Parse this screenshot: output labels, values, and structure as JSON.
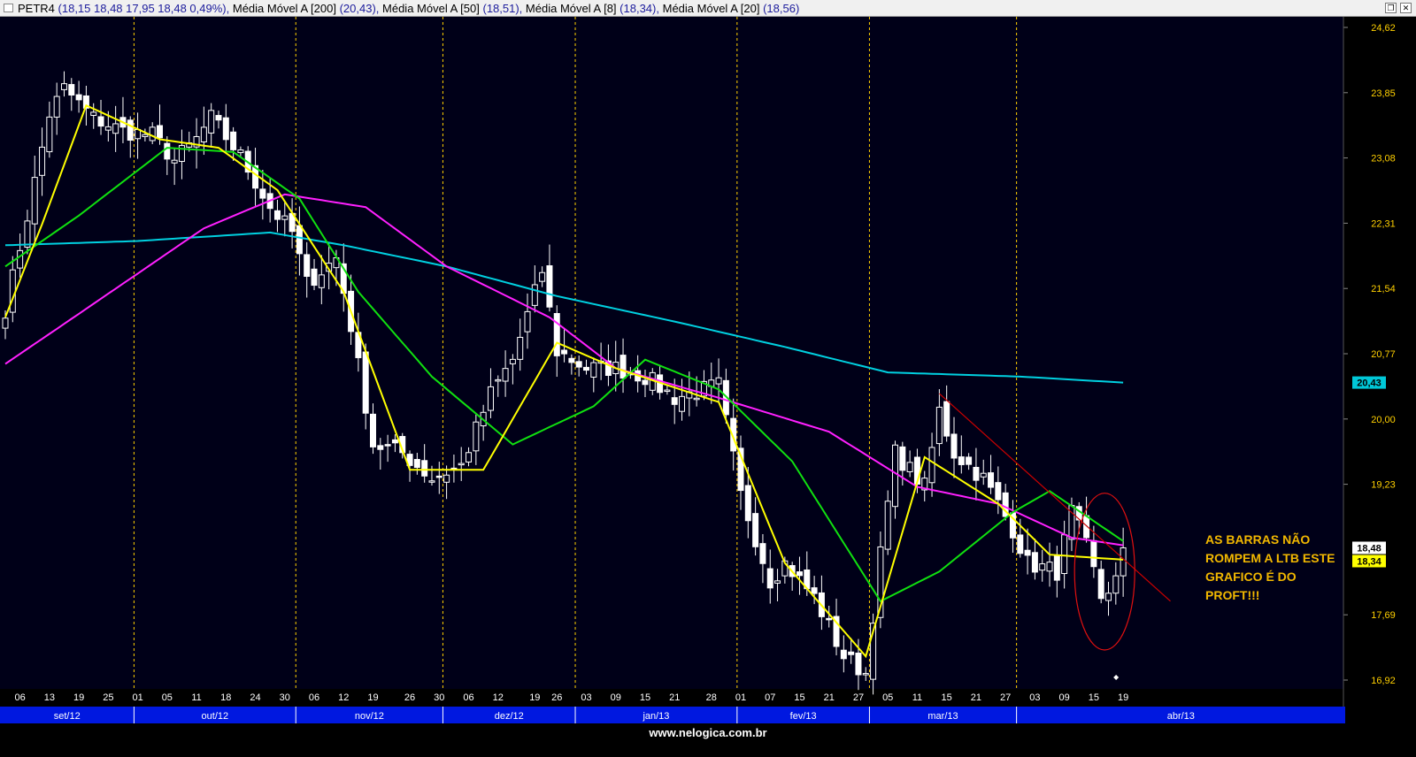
{
  "header": {
    "ticker": "PETR4",
    "ticker_values": "(18,15  18,48  17,95  18,48  0,49%),",
    "ma200_label": "Média Móvel A [200]",
    "ma200_value": "(20,43),",
    "ma50_label": "Média Móvel A [50]",
    "ma50_value": "(18,51),",
    "ma8_label": "Média Móvel A [8]",
    "ma8_value": "(18,34),",
    "ma20_label": "Média Móvel A [20]",
    "ma20_value": "(18,56)"
  },
  "annotation": {
    "lines": [
      "AS BARRAS NÃO",
      "ROMPEM A LTB ESTE",
      "GRAFICO É  DO",
      "PROFT!!!"
    ],
    "color": "#f2b800"
  },
  "footer": {
    "site": "www.nelogica.com.br"
  },
  "chart_data": {
    "type": "candlestick",
    "ylim": [
      16.92,
      24.62
    ],
    "y_ticks": [
      "24,62",
      "23,85",
      "23,08",
      "22,31",
      "21,54",
      "20,77",
      "20,00",
      "19,23",
      "17,69",
      "16,92"
    ],
    "x_tick_labels": [
      "06",
      "13",
      "19",
      "25",
      "01",
      "05",
      "11",
      "18",
      "24",
      "30",
      "06",
      "12",
      "19",
      "26",
      "30",
      "06",
      "12",
      "19",
      "26",
      "03",
      "09",
      "15",
      "21",
      "28",
      "01",
      "07",
      "15",
      "21",
      "27",
      "05",
      "11",
      "15",
      "21",
      "27",
      "03",
      "09",
      "15",
      "19"
    ],
    "months": [
      "set/12",
      "out/12",
      "nov/12",
      "dez/12",
      "jan/13",
      "fev/13",
      "mar/13",
      "abr/13"
    ],
    "price_tags": [
      {
        "text": "20,43",
        "value": 20.43,
        "bg": "#00c8d8"
      },
      {
        "text": "18,48",
        "value": 18.48,
        "bg": "#ffffff"
      },
      {
        "text": "18,34",
        "value": 18.34,
        "bg": "#ffff00"
      }
    ],
    "colors": {
      "background": "#000018",
      "candle": "#ffffff",
      "ma200": "#00d0e0",
      "ma50": "#ff20ff",
      "ma20": "#10e010",
      "ma8": "#ffff00",
      "month_separator": "#ffd000",
      "trendline": "#cc0000",
      "axis_text": "#ffd000",
      "month_bar": "#0018e0"
    },
    "candles_close_anchors": [
      {
        "date": "2012-09-04",
        "close": 21.3
      },
      {
        "date": "2012-09-10",
        "close": 22.4
      },
      {
        "date": "2012-09-13",
        "close": 23.6
      },
      {
        "date": "2012-09-17",
        "close": 23.9
      },
      {
        "date": "2012-09-21",
        "close": 23.55
      },
      {
        "date": "2012-09-27",
        "close": 23.4
      },
      {
        "date": "2012-10-03",
        "close": 23.35
      },
      {
        "date": "2012-10-08",
        "close": 23.05
      },
      {
        "date": "2012-10-11",
        "close": 23.3
      },
      {
        "date": "2012-10-16",
        "close": 23.55
      },
      {
        "date": "2012-10-22",
        "close": 23.1
      },
      {
        "date": "2012-10-26",
        "close": 22.5
      },
      {
        "date": "2012-10-31",
        "close": 22.2
      },
      {
        "date": "2012-11-05",
        "close": 21.6
      },
      {
        "date": "2012-11-09",
        "close": 21.9
      },
      {
        "date": "2012-11-13",
        "close": 21.1
      },
      {
        "date": "2012-11-19",
        "close": 19.7
      },
      {
        "date": "2012-11-23",
        "close": 19.6
      },
      {
        "date": "2012-11-29",
        "close": 19.3
      },
      {
        "date": "2012-12-05",
        "close": 19.45
      },
      {
        "date": "2012-12-11",
        "close": 20.3
      },
      {
        "date": "2012-12-14",
        "close": 20.7
      },
      {
        "date": "2012-12-20",
        "close": 21.75
      },
      {
        "date": "2012-12-26",
        "close": 20.8
      },
      {
        "date": "2013-01-03",
        "close": 20.6
      },
      {
        "date": "2013-01-09",
        "close": 20.6
      },
      {
        "date": "2013-01-15",
        "close": 20.5
      },
      {
        "date": "2013-01-21",
        "close": 20.25
      },
      {
        "date": "2013-01-29",
        "close": 20.4
      },
      {
        "date": "2013-02-01",
        "close": 19.1
      },
      {
        "date": "2013-02-07",
        "close": 18.1
      },
      {
        "date": "2013-02-13",
        "close": 18.3
      },
      {
        "date": "2013-02-19",
        "close": 17.9
      },
      {
        "date": "2013-02-25",
        "close": 17.2
      },
      {
        "date": "2013-02-28",
        "close": 17.0
      },
      {
        "date": "2013-03-04",
        "close": 18.4
      },
      {
        "date": "2013-03-06",
        "close": 19.6
      },
      {
        "date": "2013-03-12",
        "close": 19.2
      },
      {
        "date": "2013-03-14",
        "close": 20.1
      },
      {
        "date": "2013-03-18",
        "close": 19.6
      },
      {
        "date": "2013-03-22",
        "close": 19.3
      },
      {
        "date": "2013-03-28",
        "close": 18.7
      },
      {
        "date": "2013-04-02",
        "close": 18.3
      },
      {
        "date": "2013-04-08",
        "close": 18.2
      },
      {
        "date": "2013-04-10",
        "close": 18.9
      },
      {
        "date": "2013-04-12",
        "close": 18.5
      },
      {
        "date": "2013-04-16",
        "close": 17.9
      },
      {
        "date": "2013-04-18",
        "close": 18.1
      },
      {
        "date": "2013-04-19",
        "close": 18.48
      }
    ],
    "ma200_values": [
      {
        "date": "2012-09-04",
        "value": 22.05
      },
      {
        "date": "2012-10-01",
        "value": 22.1
      },
      {
        "date": "2012-10-26",
        "value": 22.2
      },
      {
        "date": "2012-11-12",
        "value": 22.05
      },
      {
        "date": "2012-12-03",
        "value": 21.8
      },
      {
        "date": "2012-12-26",
        "value": 21.45
      },
      {
        "date": "2013-01-21",
        "value": 21.15
      },
      {
        "date": "2013-02-13",
        "value": 20.85
      },
      {
        "date": "2013-03-05",
        "value": 20.55
      },
      {
        "date": "2013-04-01",
        "value": 20.5
      },
      {
        "date": "2013-04-19",
        "value": 20.43
      }
    ],
    "ma50_values": [
      {
        "date": "2012-09-04",
        "value": 20.65
      },
      {
        "date": "2012-09-20",
        "value": 21.3
      },
      {
        "date": "2012-10-15",
        "value": 22.25
      },
      {
        "date": "2012-10-30",
        "value": 22.65
      },
      {
        "date": "2012-11-15",
        "value": 22.5
      },
      {
        "date": "2012-12-03",
        "value": 21.8
      },
      {
        "date": "2012-12-21",
        "value": 21.2
      },
      {
        "date": "2013-01-09",
        "value": 20.6
      },
      {
        "date": "2013-01-29",
        "value": 20.25
      },
      {
        "date": "2013-02-21",
        "value": 19.85
      },
      {
        "date": "2013-03-11",
        "value": 19.2
      },
      {
        "date": "2013-03-26",
        "value": 19.0
      },
      {
        "date": "2013-04-10",
        "value": 18.6
      },
      {
        "date": "2013-04-19",
        "value": 18.51
      }
    ],
    "ma20_values": [
      {
        "date": "2012-09-04",
        "value": 21.8
      },
      {
        "date": "2012-09-19",
        "value": 22.4
      },
      {
        "date": "2012-10-05",
        "value": 23.2
      },
      {
        "date": "2012-10-19",
        "value": 23.15
      },
      {
        "date": "2012-11-01",
        "value": 22.6
      },
      {
        "date": "2012-11-14",
        "value": 21.5
      },
      {
        "date": "2012-11-29",
        "value": 20.5
      },
      {
        "date": "2012-12-14",
        "value": 19.7
      },
      {
        "date": "2013-01-04",
        "value": 20.15
      },
      {
        "date": "2013-01-15",
        "value": 20.7
      },
      {
        "date": "2013-01-29",
        "value": 20.35
      },
      {
        "date": "2013-02-14",
        "value": 19.5
      },
      {
        "date": "2013-03-04",
        "value": 17.85
      },
      {
        "date": "2013-03-14",
        "value": 18.2
      },
      {
        "date": "2013-03-28",
        "value": 18.9
      },
      {
        "date": "2013-04-05",
        "value": 19.15
      },
      {
        "date": "2013-04-19",
        "value": 18.56
      }
    ],
    "ma8_values": [
      {
        "date": "2012-09-04",
        "value": 21.2
      },
      {
        "date": "2012-09-12",
        "value": 22.3
      },
      {
        "date": "2012-09-20",
        "value": 23.7
      },
      {
        "date": "2012-10-04",
        "value": 23.3
      },
      {
        "date": "2012-10-17",
        "value": 23.2
      },
      {
        "date": "2012-10-29",
        "value": 22.7
      },
      {
        "date": "2012-11-12",
        "value": 21.5
      },
      {
        "date": "2012-11-26",
        "value": 19.4
      },
      {
        "date": "2012-12-10",
        "value": 19.4
      },
      {
        "date": "2012-12-26",
        "value": 20.9
      },
      {
        "date": "2013-01-09",
        "value": 20.6
      },
      {
        "date": "2013-01-29",
        "value": 20.2
      },
      {
        "date": "2013-02-11",
        "value": 18.3
      },
      {
        "date": "2013-02-28",
        "value": 17.2
      },
      {
        "date": "2013-03-12",
        "value": 19.55
      },
      {
        "date": "2013-03-26",
        "value": 19.0
      },
      {
        "date": "2013-04-05",
        "value": 18.4
      },
      {
        "date": "2013-04-19",
        "value": 18.34
      }
    ],
    "trendline": [
      {
        "date": "2013-03-14",
        "value": 20.3
      },
      {
        "date": "2013-04-28",
        "value": 17.85
      }
    ]
  }
}
